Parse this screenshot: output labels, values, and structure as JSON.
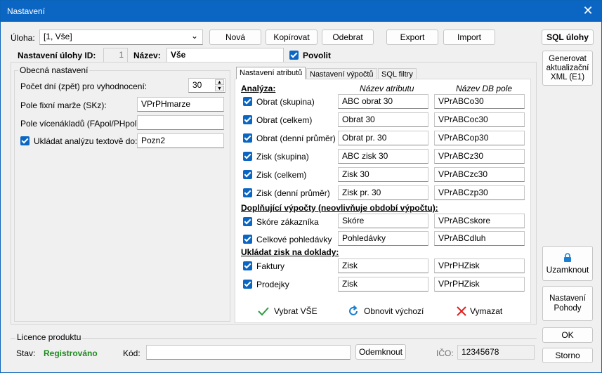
{
  "window": {
    "title": "Nastavení",
    "close_glyph": "✕"
  },
  "top": {
    "uloha_label": "Úloha:",
    "uloha_value": "[1, Vše]",
    "buttons": {
      "nova": "Nová",
      "kopirovat": "Kopírovat",
      "odebrat": "Odebrat",
      "export": "Export",
      "import": "Import",
      "sql": "SQL úlohy"
    }
  },
  "task": {
    "id_label": "Nastavení úlohy ID:",
    "id_value": "1",
    "name_label": "Název:",
    "name_value": "Vše",
    "enable_label": "Povolit"
  },
  "general": {
    "title": "Obecná nastavení",
    "days_label": "Počet dní (zpět) pro vyhodnocení:",
    "days_value": "30",
    "fixed_margin_label": "Pole fixní marže (SKz):",
    "fixed_margin_value": "VPrPHmarze",
    "overhead_label": "Pole vícenákladů (FApol/PHpol):",
    "overhead_value": "",
    "save_text_label": "Ukládat analýzu textově do:",
    "save_text_value": "Pozn2"
  },
  "tabs": [
    "Nastavení atributů",
    "Nastavení výpočtů",
    "SQL filtry"
  ],
  "attrs": {
    "section_analyza": "Analýza:",
    "col_attr": "Název atributu",
    "col_db": "Název DB pole",
    "analyza": [
      {
        "label": "Obrat (skupina)",
        "attr": "ABC obrat 30",
        "db": "VPrABCo30"
      },
      {
        "label": "Obrat (celkem)",
        "attr": "Obrat 30",
        "db": "VPrABCoc30"
      },
      {
        "label": "Obrat (denní průměr)",
        "attr": "Obrat pr. 30",
        "db": "VPrABCop30"
      },
      {
        "label": "Zisk (skupina)",
        "attr": "ABC zisk 30",
        "db": "VPrABCz30"
      },
      {
        "label": "Zisk (celkem)",
        "attr": "Zisk 30",
        "db": "VPrABCzc30"
      },
      {
        "label": "Zisk (denní průměr)",
        "attr": "Zisk pr. 30",
        "db": "VPrABCzp30"
      }
    ],
    "section_extra": "Doplňující výpočty (neovlivňuje období výpočtu):",
    "extra": [
      {
        "label": "Skóre zákazníka",
        "attr": "Skóre",
        "db": "VPrABCskore"
      },
      {
        "label": "Celkové pohledávky",
        "attr": "Pohledávky",
        "db": "VPrABCdluh"
      }
    ],
    "section_docs": "Ukládat zisk na doklady:",
    "docs": [
      {
        "label": "Faktury",
        "attr": "Zisk",
        "db": "VPrPHZisk"
      },
      {
        "label": "Prodejky",
        "attr": "Zisk",
        "db": "VPrPHZisk"
      }
    ],
    "actions": {
      "select_all": "Vybrat VŠE",
      "restore": "Obnovit výchozí",
      "clear": "Vymazat"
    }
  },
  "side": {
    "generate": "Generovat aktualizační XML (E1)",
    "lock": "Uzamknout",
    "settings_pohoda": "Nastavení Pohody",
    "ok": "OK",
    "cancel": "Storno"
  },
  "license": {
    "title": "Licence produktu",
    "state_label": "Stav:",
    "state_value": "Registrováno",
    "code_label": "Kód:",
    "code_value": "",
    "unlock": "Odemknout",
    "ico_label": "IČO:",
    "ico_value": "12345678"
  },
  "colors": {
    "accent": "#0b66c3",
    "registered": "#1e8a1e",
    "check": "#2e9e3e",
    "refresh": "#1a7fd0",
    "clear": "#e02020"
  }
}
